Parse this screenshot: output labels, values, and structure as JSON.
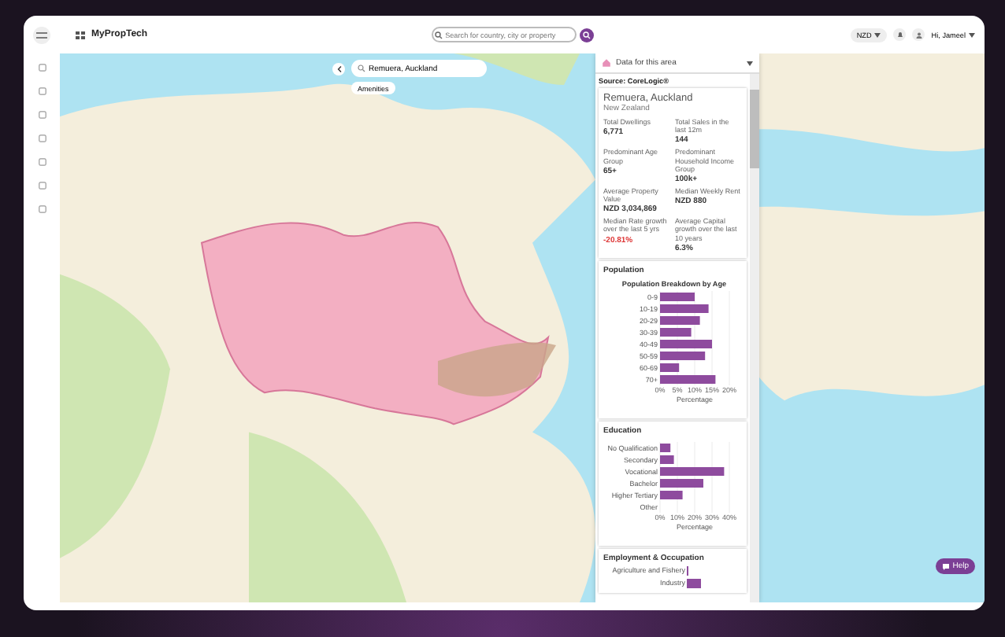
{
  "topbar": {
    "brand": "MyPropTech",
    "search": {
      "placeholder": "Search for country, city or property"
    },
    "currency": "NZD",
    "greeting": "Hi, Jameel"
  },
  "map_search": {
    "value": "Remuera, Auckland",
    "chip": "Amenities"
  },
  "panel": {
    "title": "Data for this area",
    "source": "Source: CoreLogic®",
    "place": "Remuera, Auckland",
    "country": "New Zealand",
    "stats": [
      {
        "label": "Total Dwellings",
        "value": "6,771",
        "negative": false
      },
      {
        "label": "Total Sales in the last 12m",
        "value": "144",
        "negative": false
      },
      {
        "label": "Predominant Age Group",
        "value": "65+",
        "negative": false
      },
      {
        "label": "Predominant Household Income Group",
        "value": "100k+",
        "negative": false
      },
      {
        "label": "Average Property Value",
        "value": "NZD 3,034,869",
        "negative": false
      },
      {
        "label": "Median Weekly Rent",
        "value": "NZD 880",
        "negative": false
      },
      {
        "label": "Median Rate growth over the last 5 yrs",
        "value": "-20.81%",
        "negative": true
      },
      {
        "label": "Average Capital growth over the last 10 years",
        "value": "6.3%",
        "negative": false
      }
    ],
    "sections": [
      {
        "title": "Population",
        "kind": "chart",
        "chart_data": {
          "type": "bar",
          "orientation": "horizontal",
          "title": "Population Breakdown by Age",
          "xlabel": "Percentage",
          "categories": [
            "0-9",
            "10-19",
            "20-29",
            "30-39",
            "40-49",
            "50-59",
            "60-69",
            "70+"
          ],
          "values": [
            10,
            14,
            11.5,
            9,
            15,
            13,
            5.5,
            16
          ],
          "xlim": [
            0,
            20
          ],
          "grid": true,
          "xticks": [
            {
              "value": 0,
              "label": "0%"
            },
            {
              "value": 5,
              "label": "5%"
            },
            {
              "value": 10,
              "label": "10%"
            },
            {
              "value": 15,
              "label": "15%"
            },
            {
              "value": 20,
              "label": "20%"
            }
          ]
        }
      },
      {
        "title": "Education",
        "kind": "chart",
        "chart_data": {
          "type": "bar",
          "orientation": "horizontal",
          "xlabel": "Percentage",
          "categories": [
            "No Qualification",
            "Secondary",
            "Vocational",
            "Bachelor",
            "Higher Tertiary",
            "Other"
          ],
          "values": [
            6,
            8,
            37,
            25,
            13,
            0
          ],
          "xlim": [
            0,
            40
          ],
          "grid": true,
          "xticks": [
            {
              "value": 0,
              "label": "0%"
            },
            {
              "value": 10,
              "label": "10%"
            },
            {
              "value": 20,
              "label": "20%"
            },
            {
              "value": 30,
              "label": "30%"
            },
            {
              "value": 40,
              "label": "40%"
            }
          ]
        }
      },
      {
        "title": "Employment & Occupation",
        "kind": "picture",
        "labels": [
          "Agriculture and Fishery",
          "Industry"
        ]
      }
    ]
  },
  "help": "Help"
}
